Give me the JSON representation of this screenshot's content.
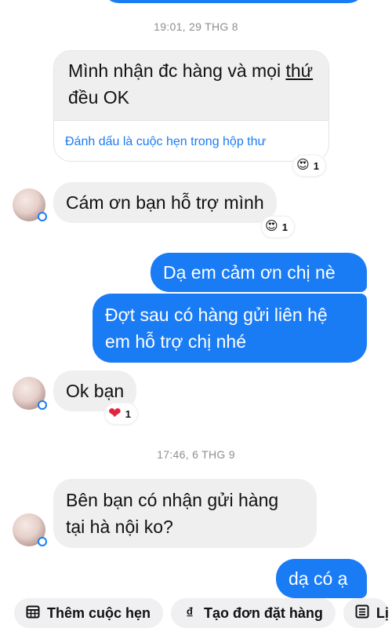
{
  "timestamps": [
    "19:01, 29 THG 8",
    "17:46, 6 THG 9"
  ],
  "card": {
    "text_before": "Mình nhận đc hàng và mọi ",
    "text_underlined": "thứ",
    "text_after": " đều OK",
    "action": "Đánh dấu là cuộc hẹn trong hộp thư"
  },
  "messages": {
    "recv1": "Cám ơn bạn hỗ trợ mình",
    "sent1": "Dạ em cảm ơn chị nè",
    "sent2_line1": "Đợt sau có hàng gửi liên hệ",
    "sent2_line2": "em hỗ trợ chị nhé",
    "recv2": "Ok bạn",
    "recv3_line1": "Bên bạn có nhận gửi hàng",
    "recv3_line2": "tại hà nội ko?",
    "sent3": "dạ có ạ"
  },
  "reactions": {
    "card": {
      "emoji": "😍",
      "count": "1"
    },
    "recv1": {
      "emoji": "😍",
      "count": "1"
    },
    "recv2": {
      "emoji": "❤",
      "count": "1"
    }
  },
  "toolbar": {
    "items": [
      {
        "label": "Thêm cuộc hẹn",
        "icon": "calendar-icon"
      },
      {
        "label": "Tạo đơn đặt hàng",
        "icon": "dong-currency-icon"
      },
      {
        "label": "Lị",
        "icon": "list-icon"
      }
    ]
  },
  "colors": {
    "sent_bubble": "#1a7cf5",
    "received_bubble": "#efeff0",
    "link": "#1a7cf5"
  }
}
